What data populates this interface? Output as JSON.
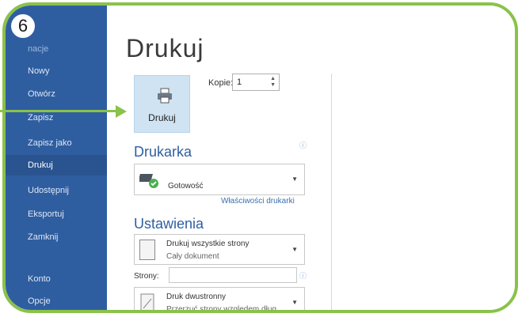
{
  "step_badge": "6",
  "sidebar": {
    "items": [
      {
        "label": "nacje"
      },
      {
        "label": "Nowy"
      },
      {
        "label": "Otwórz"
      },
      {
        "label": "Zapisz"
      },
      {
        "label": "Zapisz jako"
      },
      {
        "label": "Drukuj"
      },
      {
        "label": "Udostępnij"
      },
      {
        "label": "Eksportuj"
      },
      {
        "label": "Zamknij"
      },
      {
        "label": "Konto"
      },
      {
        "label": "Opcje"
      }
    ]
  },
  "main": {
    "title": "Drukuj",
    "print_button_label": "Drukuj",
    "copies_label": "Kopie:",
    "copies_value": "1",
    "printer_section": "Drukarka",
    "printer_status": "Gotowość",
    "printer_properties_link": "Właściwości drukarki",
    "settings_section": "Ustawienia",
    "pages_dropdown": {
      "title": "Drukuj wszystkie strony",
      "subtitle": "Cały dokument"
    },
    "pages_label": "Strony:",
    "pages_value": "",
    "duplex_dropdown": {
      "title": "Druk dwustronny",
      "subtitle": "Przerzuć strony względem dług..."
    }
  },
  "colors": {
    "accent_green": "#8ac24a",
    "sidebar_blue": "#2f5ea0",
    "heading_blue": "#2f5ea0"
  }
}
